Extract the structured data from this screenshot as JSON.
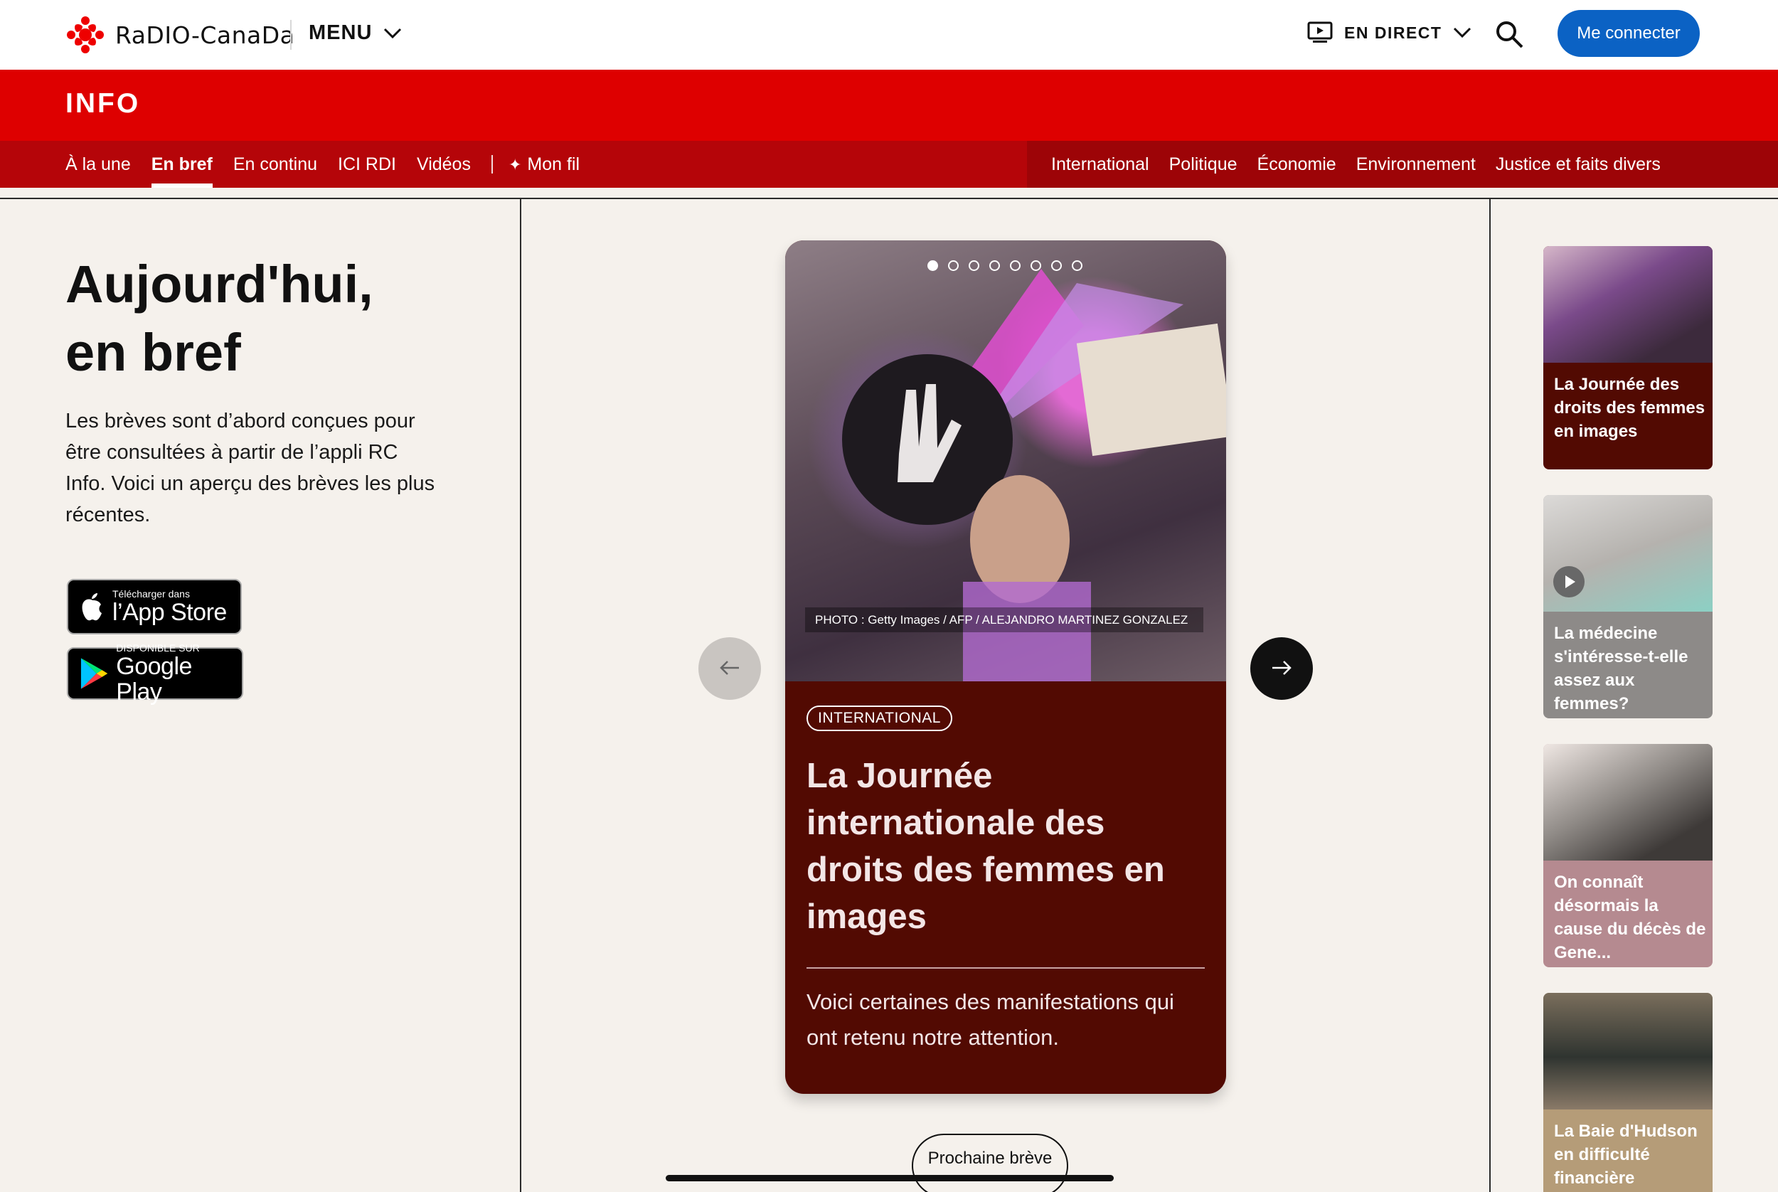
{
  "header": {
    "logo_text": "RaDIO-CanaDa",
    "menu_label": "MENU",
    "live_label": "EN DIRECT",
    "connect_label": "Me connecter"
  },
  "section": {
    "title": "INFO"
  },
  "subnav": {
    "left": [
      "À la une",
      "En bref",
      "En continu",
      "ICI RDI",
      "Vidéos"
    ],
    "active": "En bref",
    "my_feed": "Mon fil",
    "right": [
      "International",
      "Politique",
      "Économie",
      "Environnement",
      "Justice et faits divers"
    ]
  },
  "left": {
    "title_line1": "Aujourd'hui,",
    "title_line2": "en bref",
    "intro": "Les brèves sont d’abord conçues pour être consultées à partir de l’appli RC Info. Voici un aperçu des brèves les plus récentes.",
    "apple_small": "Télécharger dans",
    "apple_big": "l’App Store",
    "google_small": "DISPONIBLE SUR",
    "google_big": "Google Play"
  },
  "story": {
    "photo_credit": "PHOTO : Getty Images / AFP / ALEJANDRO MARTINEZ GONZALEZ",
    "tag": "INTERNATIONAL",
    "title": "La Journée internationale des droits des femmes en images",
    "description": "Voici certaines des manifestations qui ont retenu notre attention.",
    "dots_total": 8,
    "dots_active": 1
  },
  "next_brief_label": "Prochaine brève",
  "thumbnails": [
    {
      "title": "La Journée des droits des femmes en images"
    },
    {
      "title": "La médecine s'intéresse-t-elle assez aux femmes?"
    },
    {
      "title": "On connaît désormais la cause du décès de Gene..."
    },
    {
      "title": "La Baie d'Hudson en difficulté financière"
    }
  ],
  "colors": {
    "brand_red": "#de0000",
    "subnav_red": "#b50509",
    "card_brown": "#520a02",
    "connect_blue": "#0b62c4"
  }
}
